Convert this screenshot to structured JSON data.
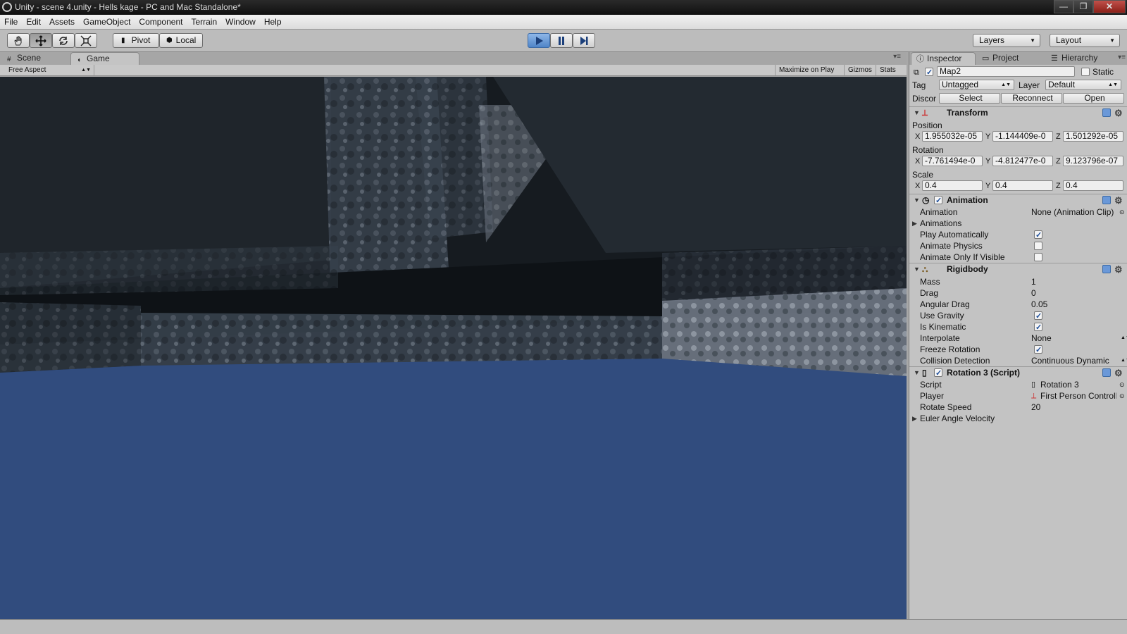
{
  "window": {
    "title": "Unity - scene 4.unity - Hells kage - PC and Mac Standalone*",
    "minimize": "—",
    "maximize": "❐",
    "close": "✕"
  },
  "menu": [
    "File",
    "Edit",
    "Assets",
    "GameObject",
    "Component",
    "Terrain",
    "Window",
    "Help"
  ],
  "toolbar": {
    "pivot_label": "Pivot",
    "local_label": "Local",
    "layers_label": "Layers",
    "layout_label": "Layout"
  },
  "game_panel": {
    "tabs": [
      {
        "label": "Scene",
        "icon": "grid-icon"
      },
      {
        "label": "Game",
        "icon": "pacman-icon"
      }
    ],
    "aspect": "Free Aspect",
    "maximize_on_play": "Maximize on Play",
    "gizmos": "Gizmos",
    "stats": "Stats"
  },
  "inspector": {
    "tabs": [
      "Inspector",
      "Project",
      "Hierarchy"
    ],
    "object_name": "Map2",
    "static_label": "Static",
    "tag_label": "Tag",
    "tag_value": "Untagged",
    "layer_label": "Layer",
    "layer_value": "Default",
    "prefab_label": "Discor",
    "prefab_select": "Select",
    "prefab_reconnect": "Reconnect",
    "prefab_open": "Open",
    "transform": {
      "title": "Transform",
      "position_label": "Position",
      "position": {
        "x": "1.955032e-05",
        "y": "-1.144409e-0",
        "z": "1.501292e-05"
      },
      "rotation_label": "Rotation",
      "rotation": {
        "x": "-7.761494e-0",
        "y": "-4.812477e-0",
        "z": "9.123796e-07"
      },
      "scale_label": "Scale",
      "scale": {
        "x": "0.4",
        "y": "0.4",
        "z": "0.4"
      }
    },
    "animation": {
      "title": "Animation",
      "animation_label": "Animation",
      "animation_value": "None (Animation Clip)",
      "animations_label": "Animations",
      "play_auto_label": "Play Automatically",
      "play_auto": true,
      "physics_label": "Animate Physics",
      "physics": false,
      "visible_label": "Animate Only If Visible",
      "visible": false
    },
    "rigidbody": {
      "title": "Rigidbody",
      "mass_label": "Mass",
      "mass": "1",
      "drag_label": "Drag",
      "drag": "0",
      "angular_drag_label": "Angular Drag",
      "angular_drag": "0.05",
      "use_gravity_label": "Use Gravity",
      "use_gravity": true,
      "is_kinematic_label": "Is Kinematic",
      "is_kinematic": true,
      "interpolate_label": "Interpolate",
      "interpolate": "None",
      "freeze_rotation_label": "Freeze Rotation",
      "freeze_rotation": true,
      "collision_label": "Collision Detection",
      "collision": "Continuous Dynamic"
    },
    "script": {
      "title": "Rotation 3 (Script)",
      "script_label": "Script",
      "script_value": "Rotation 3",
      "player_label": "Player",
      "player_value": "First Person Controller",
      "rotate_speed_label": "Rotate Speed",
      "rotate_speed": "20",
      "euler_label": "Euler Angle Velocity"
    }
  },
  "colors": {
    "play_accent": "#4f84c7",
    "water": "#314c7e",
    "stone": "#3a4450"
  }
}
